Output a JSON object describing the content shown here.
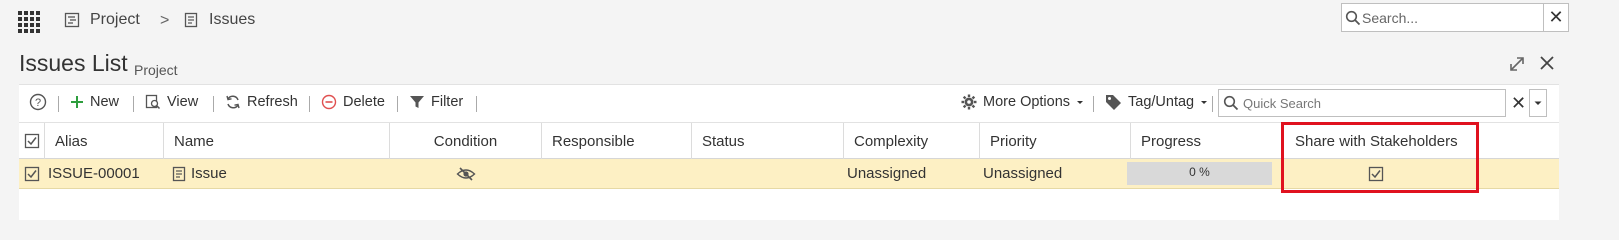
{
  "breadcrumb": {
    "project": "Project",
    "issues": "Issues",
    "separator": ">"
  },
  "search": {
    "placeholder": "Search...",
    "clear": "✕"
  },
  "page": {
    "title": "Issues List",
    "subtitle": "Project"
  },
  "toolbar": {
    "help": "?",
    "new": "New",
    "view": "View",
    "refresh": "Refresh",
    "delete": "Delete",
    "filter": "Filter",
    "more_options": "More Options",
    "tag_untag": "Tag/Untag",
    "quick_search_placeholder": "Quick Search",
    "clear": "✕"
  },
  "columns": [
    "Alias",
    "Name",
    "Condition",
    "Responsible",
    "Status",
    "Complexity",
    "Priority",
    "Progress",
    "Share with Stakeholders"
  ],
  "rows": [
    {
      "alias": "ISSUE-00001",
      "name": "Issue",
      "condition": "hidden-condition-icon",
      "responsible": "",
      "status": "",
      "complexity": "Unassigned",
      "priority": "Unassigned",
      "progress": "0 %",
      "share_with_stakeholders": true
    }
  ],
  "colors": {
    "selected_row": "#fdf0c4",
    "highlight": "#e0121f",
    "new_icon": "#2e9e3e",
    "delete_icon": "#e05050"
  }
}
